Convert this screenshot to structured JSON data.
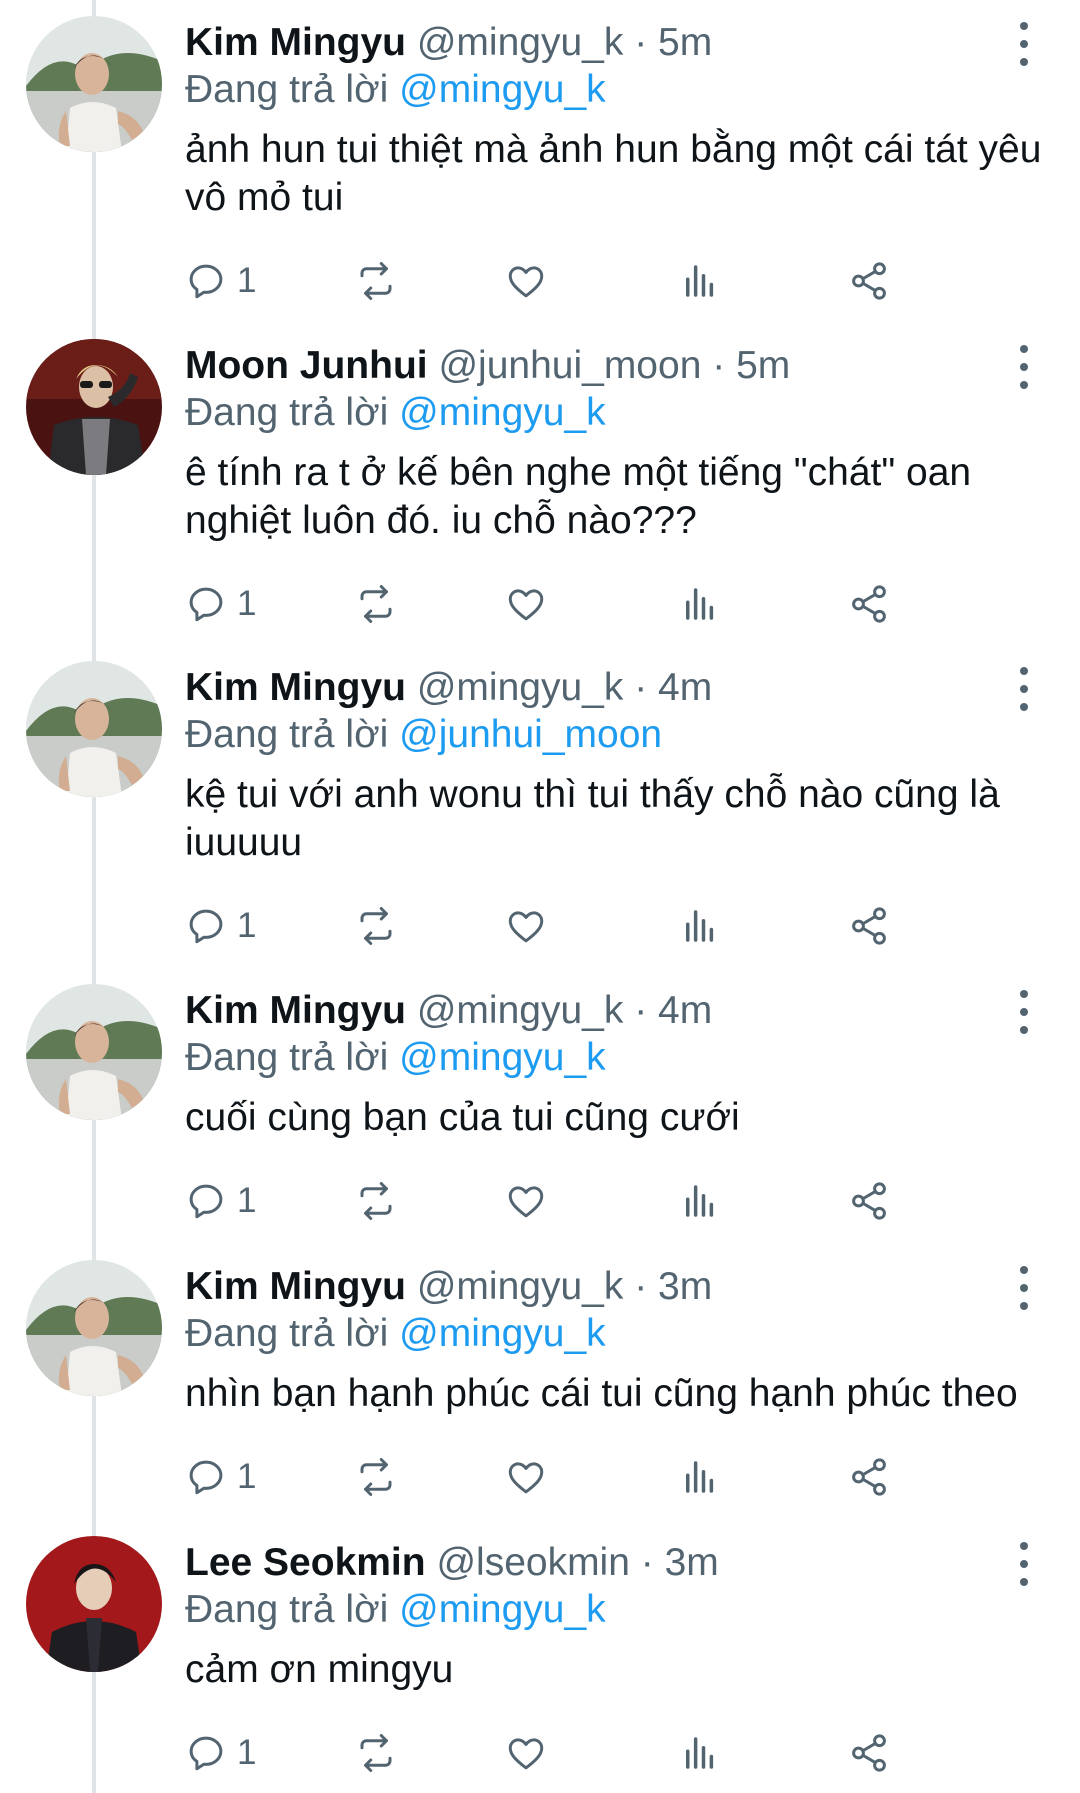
{
  "reply_prefix": "Đang trả lời",
  "colors": {
    "link": "#1d9bf0",
    "muted": "#536471",
    "text": "#0f1419",
    "thread_line": "#e1e4e7"
  },
  "icons": [
    "reply-icon",
    "retweet-icon",
    "like-icon",
    "views-icon",
    "share-icon",
    "more-icon"
  ],
  "tweets": [
    {
      "name": "Kim Mingyu",
      "handle": "@mingyu_k",
      "sep": "·",
      "time": "5m",
      "reply_to": "@mingyu_k",
      "text": "ảnh hun tui thiệt mà ảnh hun bằng một cái tát yêu vô mỏ tui",
      "reply_count": "1",
      "avatar": "avatar-mingyu"
    },
    {
      "name": "Moon Junhui",
      "handle": "@junhui_moon",
      "sep": "·",
      "time": "5m",
      "reply_to": "@mingyu_k",
      "text": "ê tính ra t ở kế bên nghe một tiếng \"chát\" oan nghiệt luôn đó. iu chỗ nào???",
      "reply_count": "1",
      "avatar": "avatar-junhui"
    },
    {
      "name": "Kim Mingyu",
      "handle": "@mingyu_k",
      "sep": "·",
      "time": "4m",
      "reply_to": "@junhui_moon",
      "text": "kệ tui với anh wonu thì tui thấy chỗ nào cũng là iuuuuu",
      "reply_count": "1",
      "avatar": "avatar-mingyu"
    },
    {
      "name": "Kim Mingyu",
      "handle": "@mingyu_k",
      "sep": "·",
      "time": "4m",
      "reply_to": "@mingyu_k",
      "text": "cuối cùng bạn của tui cũng cưới",
      "reply_count": "1",
      "avatar": "avatar-mingyu"
    },
    {
      "name": "Kim Mingyu",
      "handle": "@mingyu_k",
      "sep": "·",
      "time": "3m",
      "reply_to": "@mingyu_k",
      "text": "nhìn bạn hạnh phúc cái tui cũng hạnh phúc theo",
      "reply_count": "1",
      "avatar": "avatar-mingyu"
    },
    {
      "name": "Lee Seokmin",
      "handle": "@lseokmin",
      "sep": "·",
      "time": "3m",
      "reply_to": "@mingyu_k",
      "text": "cảm ơn mingyu",
      "reply_count": "1",
      "avatar": "avatar-seokmin"
    }
  ]
}
